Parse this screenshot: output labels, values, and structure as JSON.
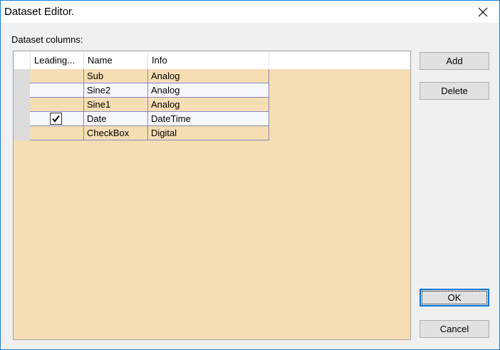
{
  "window": {
    "title": "Dataset Editor."
  },
  "section_label": "Dataset columns:",
  "grid": {
    "columns": [
      "Leading...",
      "Name",
      "Info"
    ],
    "rows": [
      {
        "leading": false,
        "name": "Sub",
        "info": "Analog"
      },
      {
        "leading": false,
        "name": "Sine2",
        "info": "Analog"
      },
      {
        "leading": false,
        "name": "Sine1",
        "info": "Analog"
      },
      {
        "leading": true,
        "name": "Date",
        "info": "DateTime"
      },
      {
        "leading": false,
        "name": "CheckBox",
        "info": "Digital"
      }
    ]
  },
  "buttons": {
    "add": "Add",
    "delete": "Delete",
    "ok": "OK",
    "cancel": "Cancel"
  },
  "colors": {
    "grid_background": "#f5deb3",
    "alt_row": "#f5f8fc",
    "cell_border": "#8c84c8",
    "accent": "#0078d7"
  }
}
